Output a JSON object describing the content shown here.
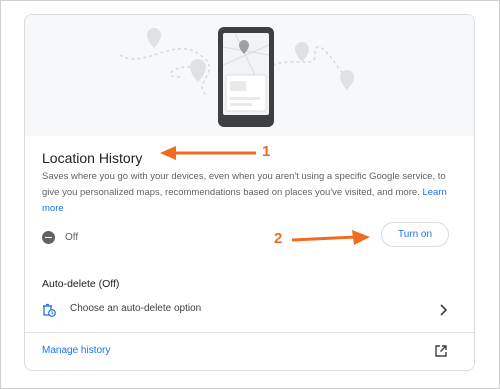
{
  "location_history": {
    "title": "Location History",
    "description": "Saves where you go with your devices, even when you aren't using a specific Google service, to give you personalized maps, recommendations based on places you've visited, and more.",
    "learn_more": "Learn more",
    "status": "Off",
    "turn_on_label": "Turn on"
  },
  "auto_delete": {
    "title": "Auto-delete (Off)",
    "option_label": "Choose an auto-delete option"
  },
  "footer": {
    "manage_label": "Manage history"
  },
  "annotations": {
    "marker_1": "1",
    "marker_2": "2"
  },
  "colors": {
    "accent": "#1a73e8",
    "annotation": "#f26b1d",
    "status_icon": "#5f6368"
  },
  "icons": [
    "off-status-icon",
    "auto-delete-icon",
    "chevron-right-icon",
    "open-in-new-icon",
    "phone-map-illustration"
  ]
}
